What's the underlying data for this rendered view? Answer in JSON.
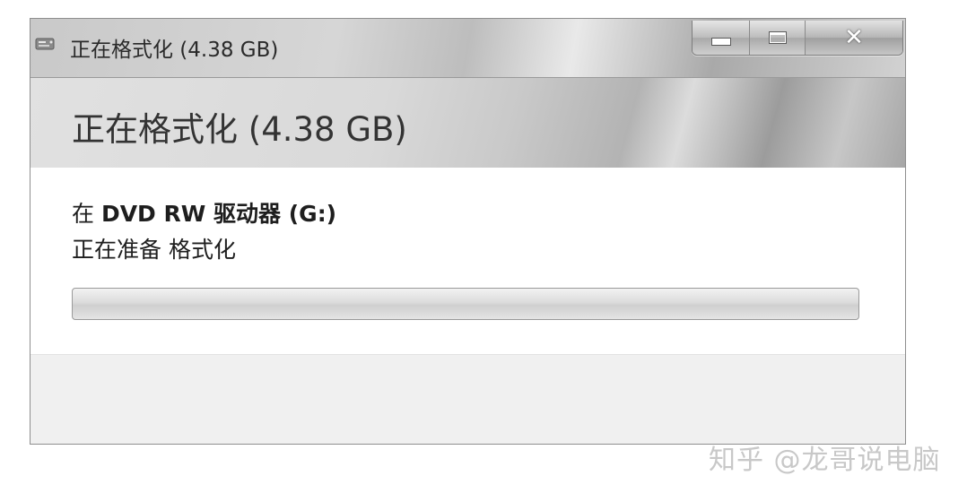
{
  "window": {
    "title": "正在格式化 (4.38 GB)",
    "controls": {
      "minimize": "minimize",
      "maximize": "maximize",
      "close": "close"
    }
  },
  "banner": {
    "title": "正在格式化 (4.38 GB)"
  },
  "content": {
    "drive_prefix": "在 ",
    "drive_name": "DVD RW 驱动器 (G:)",
    "status": "正在准备 格式化",
    "progress_fraction": 0.0
  },
  "watermark": {
    "text": "知乎 @龙哥说电脑"
  },
  "colors": {
    "accent_progress": "#4dc24d",
    "chrome_gray": "#c9c9c9"
  }
}
